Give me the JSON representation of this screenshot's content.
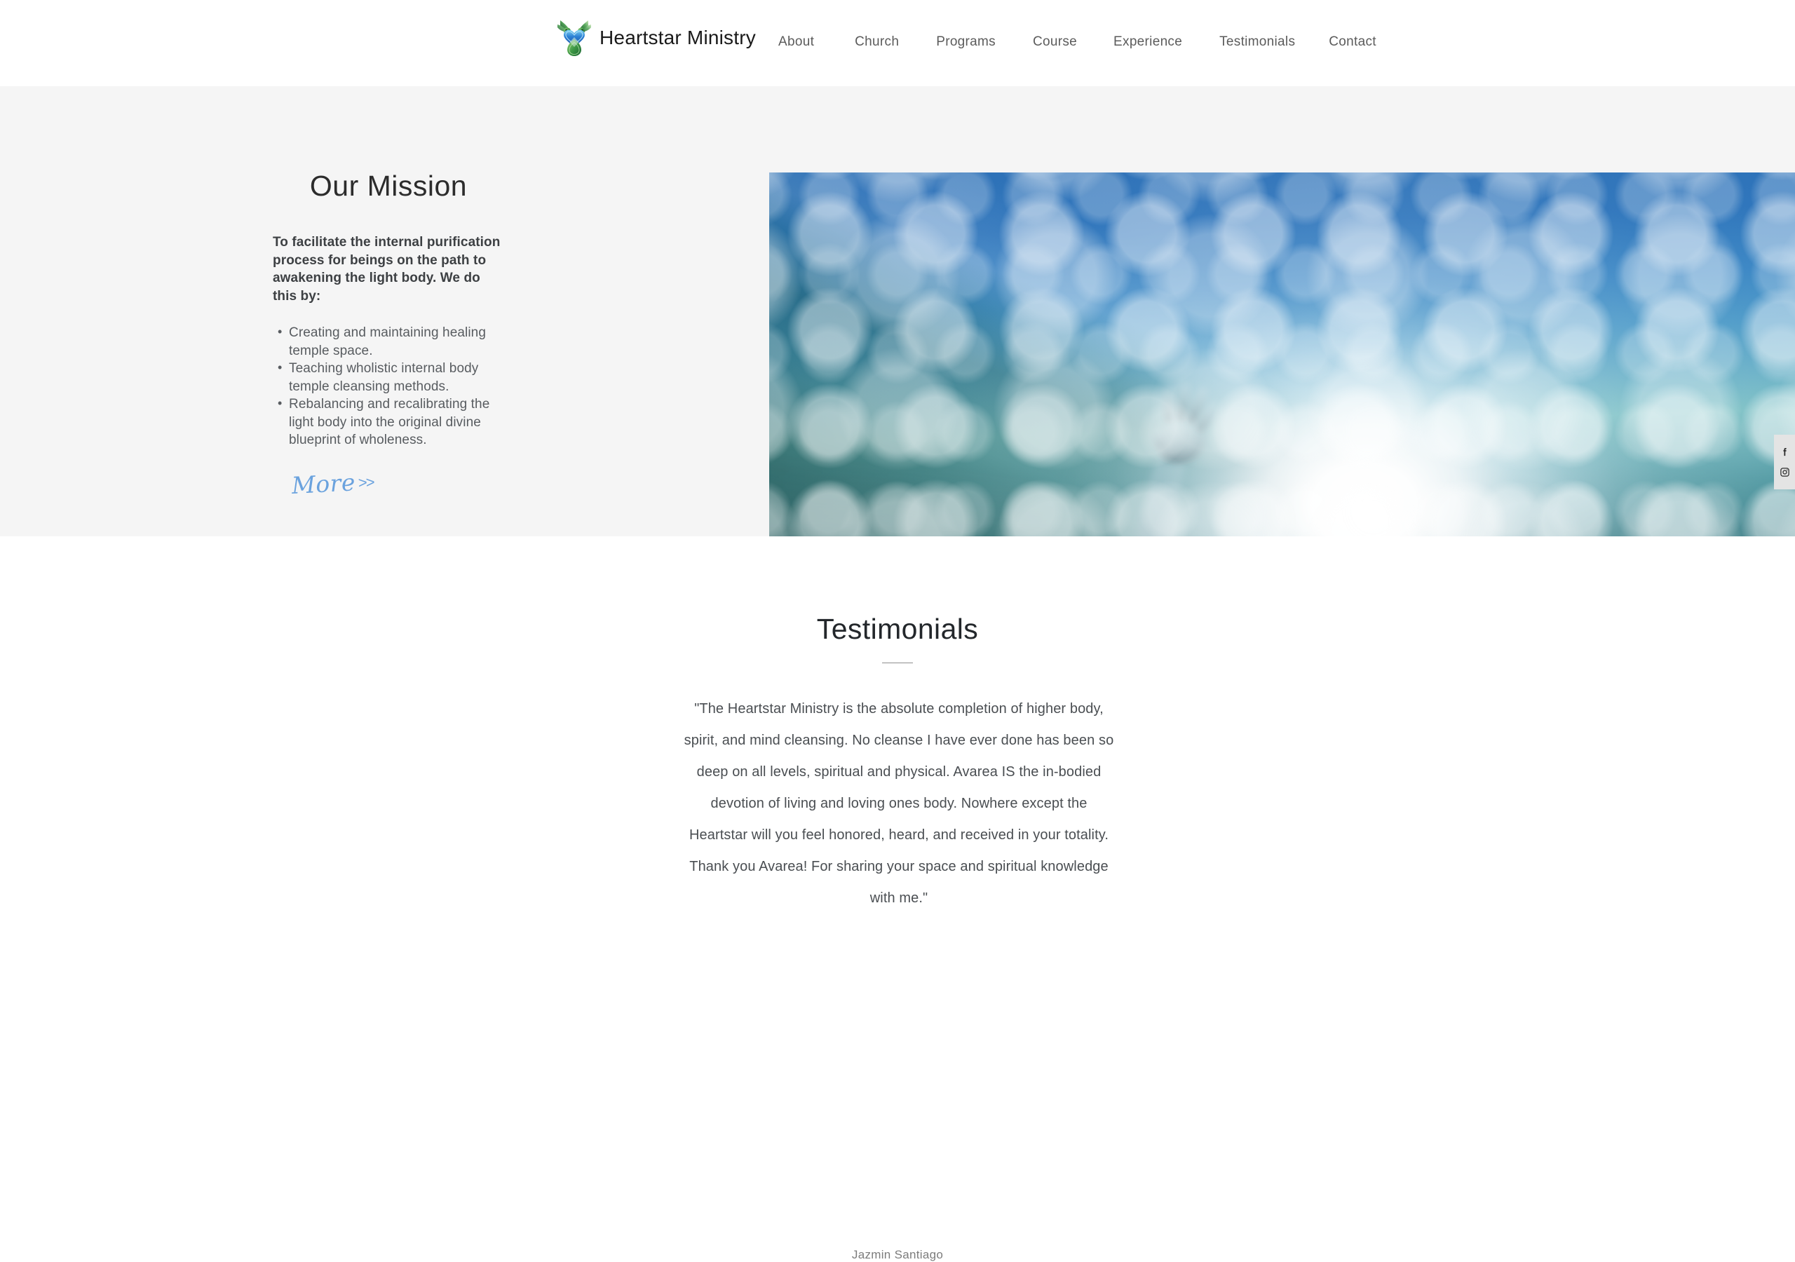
{
  "header": {
    "brand": {
      "title": "Heartstar Ministry",
      "logo_icon": "hummingbird-heart-logo"
    },
    "nav": [
      {
        "label": "About"
      },
      {
        "label": "Church"
      },
      {
        "label": "Programs"
      },
      {
        "label": "Course"
      },
      {
        "label": "Experience"
      },
      {
        "label": "Testimonials"
      },
      {
        "label": "Contact"
      }
    ]
  },
  "mission": {
    "heading": "Our Mission",
    "lead": "To facilitate the internal purification process for beings on the path to awakening the light body. We do this by:",
    "points": [
      "Creating and maintaining healing temple space.",
      "Teaching wholistic internal body temple cleansing methods.",
      "Rebalancing and recalibrating the light body into the original divine blueprint of wholeness."
    ],
    "more_label": "More",
    "more_chevrons": ">>",
    "more_color": "#6aa2de",
    "background_color": "#f5f5f5"
  },
  "hero": {
    "image_alt": "Hand reaching upward toward sunlight seen from underwater",
    "icon": "underwater-hand-reaching-light"
  },
  "social": {
    "links": [
      {
        "name": "facebook",
        "label": "Facebook"
      },
      {
        "name": "instagram",
        "label": "Instagram"
      }
    ],
    "background_color": "#e4e4e4"
  },
  "testimonials": {
    "heading": "Testimonials",
    "quote": "\"The Heartstar Ministry is the absolute completion of higher body, spirit, and mind cleansing. No cleanse I have ever done has been so deep on all levels, spiritual and physical. Avarea IS the in-bodied devotion of living and loving ones body. Nowhere except the Heartstar will you feel honored, heard, and received in your totality. Thank you Avarea! For sharing your space and spiritual knowledge with me.\"",
    "author": "Jazmin Santiago"
  }
}
